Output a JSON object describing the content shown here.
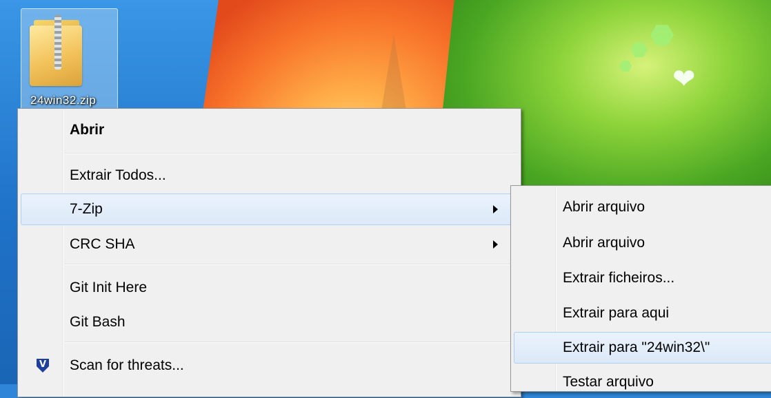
{
  "desktop": {
    "file": {
      "name": "24win32.zip",
      "icon": "zip-folder-icon"
    }
  },
  "context_menu": {
    "items": [
      {
        "label": "Abrir",
        "bold": true
      },
      {
        "label": "Extrair Todos..."
      },
      {
        "label": "7-Zip",
        "submenu": true,
        "highlighted": true
      },
      {
        "label": "CRC SHA",
        "submenu": true
      },
      {
        "label": "Git Init Here"
      },
      {
        "label": "Git Bash"
      },
      {
        "label": "Scan for threats...",
        "icon": "shield-icon"
      }
    ]
  },
  "submenu_7zip": {
    "items": [
      {
        "label": "Abrir arquivo"
      },
      {
        "label": "Abrir arquivo"
      },
      {
        "label": "Extrair ficheiros..."
      },
      {
        "label": "Extrair para aqui"
      },
      {
        "label": "Extrair para \"24win32\\\"",
        "highlighted": true
      },
      {
        "label": "Testar arquivo"
      }
    ]
  }
}
